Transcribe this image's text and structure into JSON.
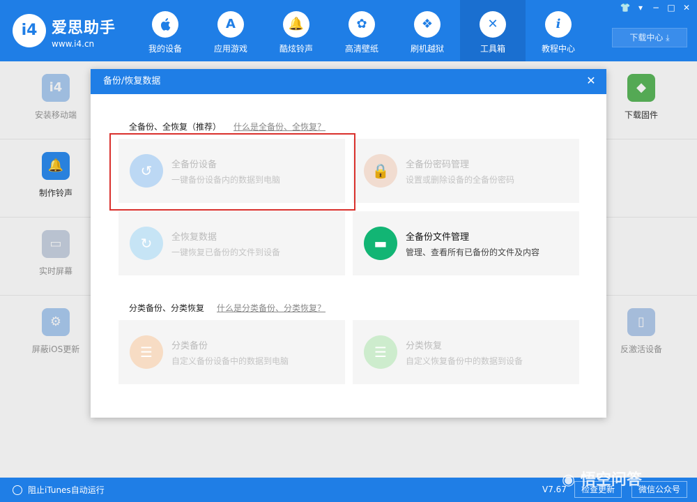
{
  "brand": {
    "name": "爱思助手",
    "url": "www.i4.cn",
    "logo_text": "i4"
  },
  "nav": [
    {
      "label": "我的设备",
      "icon": "apple-icon",
      "glyph": ""
    },
    {
      "label": "应用游戏",
      "icon": "app-store-icon",
      "glyph": "A"
    },
    {
      "label": "酷炫铃声",
      "icon": "bell-icon",
      "glyph": "🔔"
    },
    {
      "label": "高清壁纸",
      "icon": "flower-icon",
      "glyph": "✿"
    },
    {
      "label": "刷机越狱",
      "icon": "dropbox-icon",
      "glyph": "❖"
    },
    {
      "label": "工具箱",
      "icon": "tools-icon",
      "glyph": "✕"
    },
    {
      "label": "教程中心",
      "icon": "info-icon",
      "glyph": "i"
    }
  ],
  "download_center": "下载中心",
  "left_tools": [
    {
      "label": "安装移动端",
      "icon": "i4-app-icon",
      "color": "#4a90e2",
      "glyph": "i4"
    },
    {
      "label": "制作铃声",
      "icon": "bell-plus-icon",
      "color": "#2d8cf0",
      "glyph": "🔔"
    },
    {
      "label": "实时屏幕",
      "icon": "monitor-icon",
      "color": "#8aa0c0",
      "glyph": "▭"
    },
    {
      "label": "屏蔽iOS更新",
      "icon": "gear-icon",
      "color": "#4a90e2",
      "glyph": "⚙"
    }
  ],
  "right_tools": [
    {
      "label": "下载固件",
      "icon": "cube-icon",
      "color": "#5cb85c",
      "glyph": "◆"
    },
    {
      "label": "",
      "icon": "blank",
      "color": "#ffffff",
      "glyph": ""
    },
    {
      "label": "",
      "icon": "blank",
      "color": "#ffffff",
      "glyph": ""
    },
    {
      "label": "反激活设备",
      "icon": "tablet-icon",
      "color": "#5b8fd9",
      "glyph": "▯"
    }
  ],
  "dialog": {
    "title": "备份/恢复数据",
    "section1": {
      "title": "全备份、全恢复（推荐）",
      "link": "什么是全备份、全恢复？"
    },
    "section2": {
      "title": "分类备份、分类恢复",
      "link": "什么是分类备份、分类恢复？"
    },
    "cards": [
      {
        "title": "全备份设备",
        "desc": "一键备份设备内的数据到电脑",
        "icon": "backup-icon",
        "color": "#bcd8f4",
        "glyph": "↺"
      },
      {
        "title": "全备份密码管理",
        "desc": "设置或删除设备的全备份密码",
        "icon": "lock-icon",
        "color": "#f1dcd0",
        "glyph": "🔒"
      },
      {
        "title": "全恢复数据",
        "desc": "一键恢复已备份的文件到设备",
        "icon": "restore-icon",
        "color": "#c6e4f5",
        "glyph": "↻"
      },
      {
        "title": "全备份文件管理",
        "desc": "管理、查看所有已备份的文件及内容",
        "icon": "folder-icon",
        "color": "#12b574",
        "glyph": "▬"
      },
      {
        "title": "分类备份",
        "desc": "自定义备份设备中的数据到电脑",
        "icon": "category-backup-icon",
        "color": "#f7dcc4",
        "glyph": "☰"
      },
      {
        "title": "分类恢复",
        "desc": "自定义恢复备份中的数据到设备",
        "icon": "category-restore-icon",
        "color": "#cdeccd",
        "glyph": "☰"
      }
    ]
  },
  "status": {
    "itunes": "阻止iTunes自动运行",
    "version": "V7.67",
    "check_update": "检查更新",
    "wechat": "微信公众号"
  },
  "watermark": "悟空问答"
}
